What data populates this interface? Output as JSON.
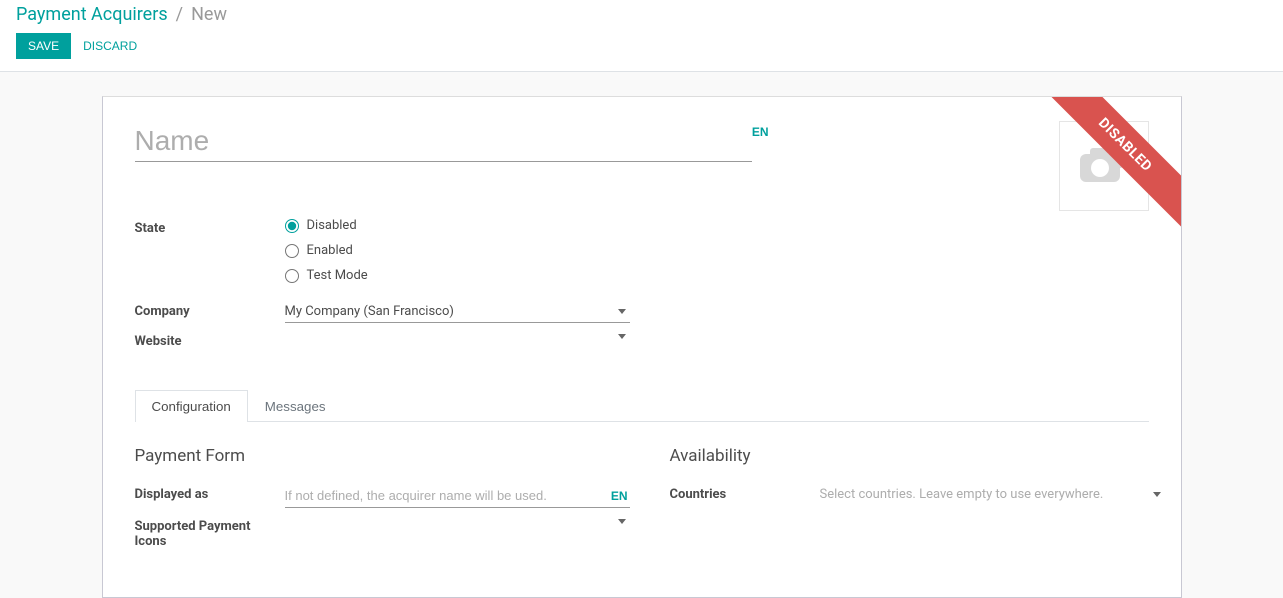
{
  "breadcrumb": {
    "parent": "Payment Acquirers",
    "current": "New"
  },
  "toolbar": {
    "save": "Save",
    "discard": "Discard"
  },
  "ribbon": "DISABLED",
  "name": {
    "placeholder": "Name",
    "value": "",
    "lang": "EN"
  },
  "fields": {
    "state": {
      "label": "State",
      "options": [
        {
          "label": "Disabled",
          "checked": true
        },
        {
          "label": "Enabled",
          "checked": false
        },
        {
          "label": "Test Mode",
          "checked": false
        }
      ]
    },
    "company": {
      "label": "Company",
      "value": "My Company (San Francisco)"
    },
    "website": {
      "label": "Website",
      "value": ""
    }
  },
  "tabs": [
    {
      "label": "Configuration",
      "active": true
    },
    {
      "label": "Messages",
      "active": false
    }
  ],
  "configuration": {
    "payment_form": {
      "title": "Payment Form",
      "displayed_as": {
        "label": "Displayed as",
        "placeholder": "If not defined, the acquirer name will be used.",
        "value": "",
        "lang": "EN"
      },
      "supported_icons": {
        "label": "Supported Payment Icons"
      }
    },
    "availability": {
      "title": "Availability",
      "countries": {
        "label": "Countries",
        "placeholder": "Select countries. Leave empty to use everywhere."
      }
    }
  }
}
